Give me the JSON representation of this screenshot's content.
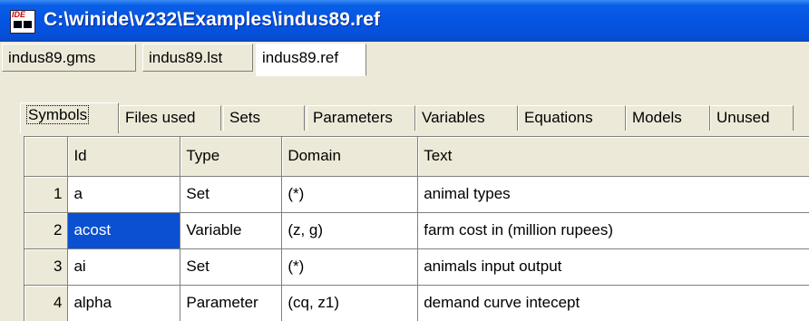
{
  "window": {
    "title": "C:\\winide\\v232\\Examples\\indus89.ref"
  },
  "file_tabs": [
    "indus89.gms",
    "indus89.lst",
    "indus89.ref"
  ],
  "active_file_tab": 2,
  "view_tabs": [
    "Symbols",
    "Files used",
    "Sets",
    "Parameters",
    "Variables",
    "Equations",
    "Models",
    "Unused"
  ],
  "active_view_tab": 0,
  "table": {
    "columns": [
      "Id",
      "Type",
      "Domain",
      "Text"
    ],
    "rows": [
      {
        "num": "1",
        "id": "a",
        "type": "Set",
        "domain": "(*)",
        "text": "animal types"
      },
      {
        "num": "2",
        "id": "acost",
        "type": "Variable",
        "domain": "(z, g)",
        "text": "farm cost in (million rupees)"
      },
      {
        "num": "3",
        "id": "ai",
        "type": "Set",
        "domain": "(*)",
        "text": "animals input output"
      },
      {
        "num": "4",
        "id": "alpha",
        "type": "Parameter",
        "domain": "(cq, z1)",
        "text": "demand curve intecept"
      }
    ],
    "selected_cell": "acost"
  },
  "colors": {
    "title_bar": "#0554e3",
    "selection": "#0a50d0",
    "window_bg": "#ece9d8"
  },
  "icons": [
    "ide-app-icon"
  ]
}
